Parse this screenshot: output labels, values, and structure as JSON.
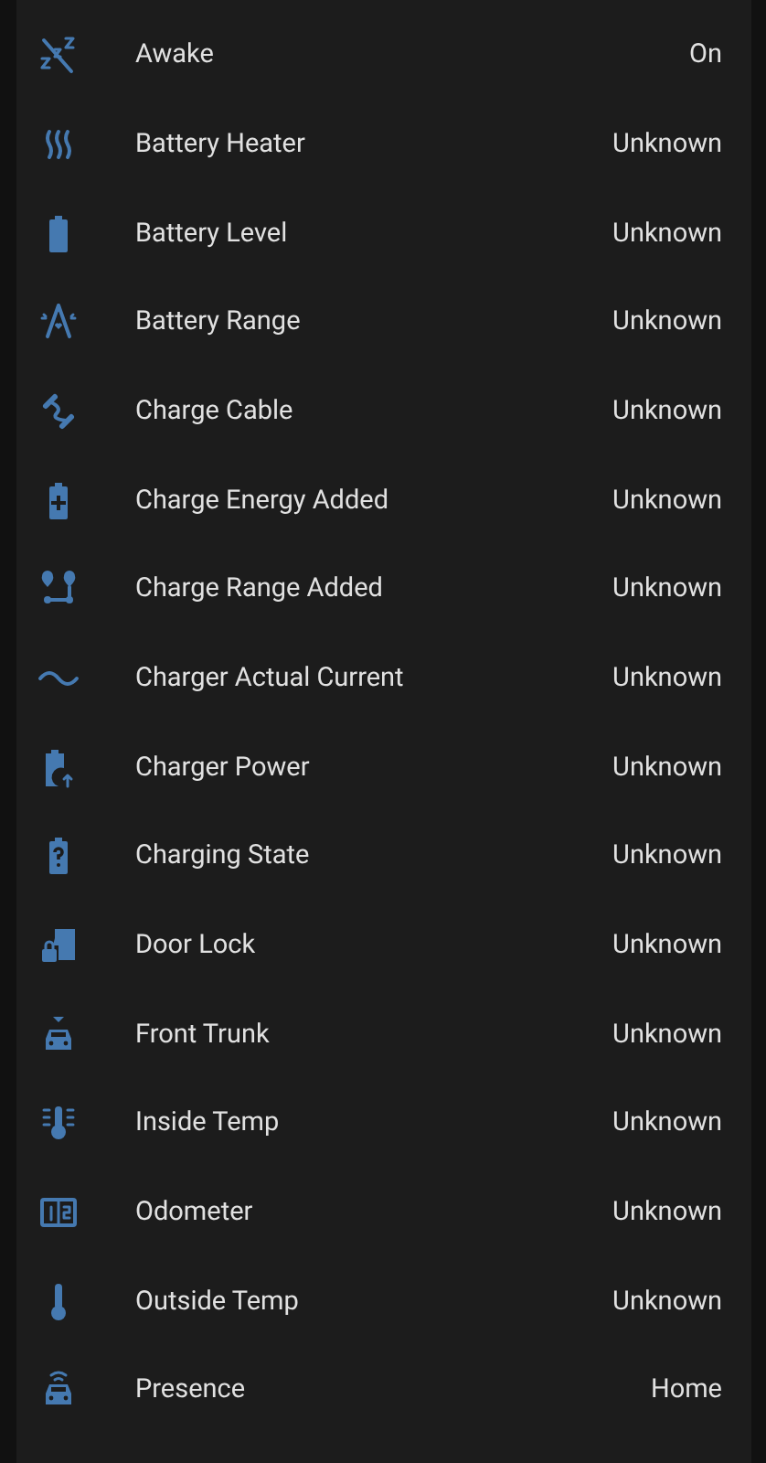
{
  "entities": [
    {
      "name": "Awake",
      "state": "On"
    },
    {
      "name": "Battery Heater",
      "state": "Unknown"
    },
    {
      "name": "Battery Level",
      "state": "Unknown"
    },
    {
      "name": "Battery Range",
      "state": "Unknown"
    },
    {
      "name": "Charge Cable",
      "state": "Unknown"
    },
    {
      "name": "Charge Energy Added",
      "state": "Unknown"
    },
    {
      "name": "Charge Range Added",
      "state": "Unknown"
    },
    {
      "name": "Charger Actual Current",
      "state": "Unknown"
    },
    {
      "name": "Charger Power",
      "state": "Unknown"
    },
    {
      "name": "Charging State",
      "state": "Unknown"
    },
    {
      "name": "Door Lock",
      "state": "Unknown"
    },
    {
      "name": "Front Trunk",
      "state": "Unknown"
    },
    {
      "name": "Inside Temp",
      "state": "Unknown"
    },
    {
      "name": "Odometer",
      "state": "Unknown"
    },
    {
      "name": "Outside Temp",
      "state": "Unknown"
    },
    {
      "name": "Presence",
      "state": "Home"
    }
  ]
}
